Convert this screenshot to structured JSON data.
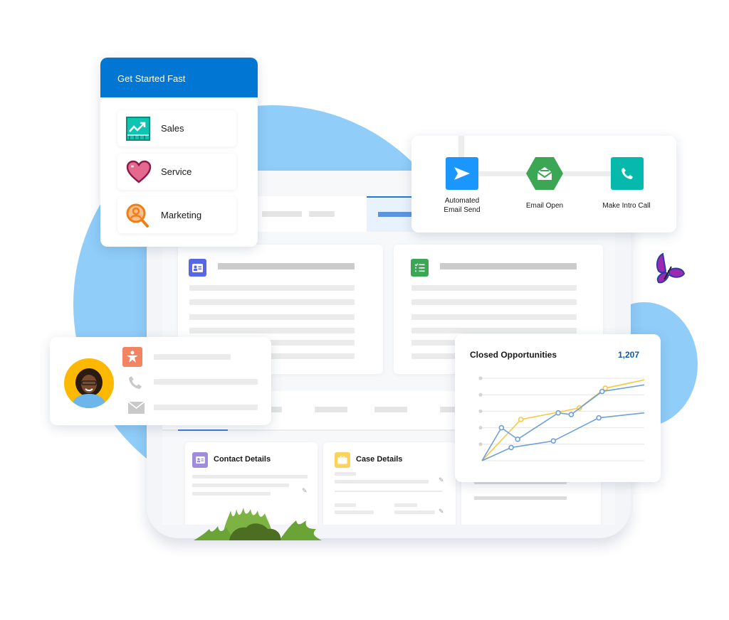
{
  "get_started": {
    "title": "Get Started Fast",
    "items": [
      {
        "label": "Sales",
        "icon": "sales-chart-icon"
      },
      {
        "label": "Service",
        "icon": "heart-icon"
      },
      {
        "label": "Marketing",
        "icon": "person-search-icon"
      }
    ]
  },
  "flow": {
    "steps": [
      {
        "label_line1": "Automated",
        "label_line2": "Email Send",
        "icon": "send-icon",
        "color": "#1b96ff"
      },
      {
        "label_line1": "Email Open",
        "label_line2": "",
        "icon": "open-envelope-icon",
        "color": "#3ba755"
      },
      {
        "label_line1": "Make Intro Call",
        "label_line2": "",
        "icon": "phone-icon",
        "color": "#06b9ad"
      }
    ]
  },
  "record": {
    "cards": [
      {
        "icon": "contact-card-icon",
        "color": "#5867e8"
      },
      {
        "icon": "checklist-icon",
        "color": "#3ba755"
      }
    ]
  },
  "details": {
    "contact_title": "Contact Details",
    "case_title": "Case Details",
    "contact_icon_color": "#9f8ddb",
    "case_icon_color": "#f9d35e"
  },
  "contact_card": {
    "avatar_bg": "#fcb900",
    "icons": [
      "person-icon",
      "phone-icon",
      "mail-icon"
    ],
    "accent": "#f38462"
  },
  "chart_data": {
    "type": "line",
    "title": "Closed Opportunities",
    "value_label": "1,207",
    "x": [
      0,
      1,
      2,
      3,
      4,
      5,
      6,
      7,
      8
    ],
    "ylim": [
      0,
      5
    ],
    "grid": true,
    "series": [
      {
        "name": "series-yellow",
        "color": "#f6c944",
        "points": [
          [
            0,
            0
          ],
          [
            2.4,
            2.5
          ],
          [
            6,
            3.2
          ],
          [
            7.6,
            4.4
          ],
          [
            10,
            4.9
          ]
        ]
      },
      {
        "name": "series-blue-1",
        "color": "#6fa0d8",
        "points": [
          [
            0,
            0
          ],
          [
            1.2,
            2.0
          ],
          [
            2.2,
            1.3
          ],
          [
            4.7,
            2.9
          ],
          [
            5.5,
            2.8
          ],
          [
            7.4,
            4.2
          ],
          [
            10,
            4.6
          ]
        ]
      },
      {
        "name": "series-blue-2",
        "color": "#6fa0d8",
        "points": [
          [
            0,
            0
          ],
          [
            1.8,
            0.8
          ],
          [
            4.4,
            1.2
          ],
          [
            7.2,
            2.6
          ],
          [
            10,
            2.9
          ]
        ]
      }
    ]
  }
}
